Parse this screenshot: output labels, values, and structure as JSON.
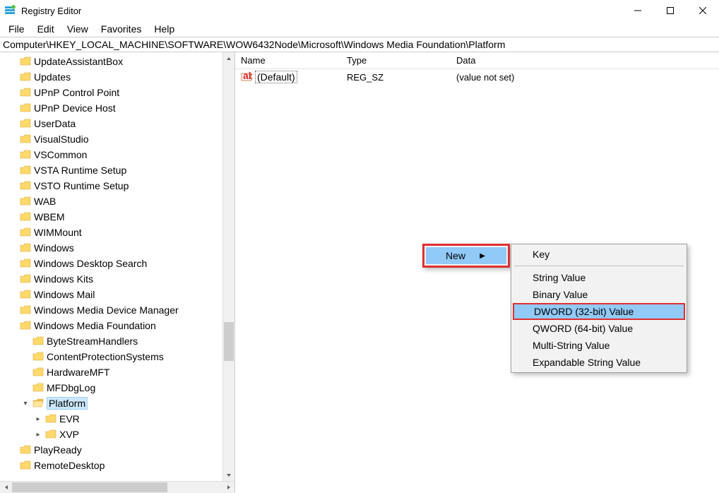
{
  "window": {
    "title": "Registry Editor"
  },
  "menubar": [
    "File",
    "Edit",
    "View",
    "Favorites",
    "Help"
  ],
  "address": "Computer\\HKEY_LOCAL_MACHINE\\SOFTWARE\\WOW6432Node\\Microsoft\\Windows Media Foundation\\Platform",
  "tree": {
    "items": [
      "UpdateAssistantBox",
      "Updates",
      "UPnP Control Point",
      "UPnP Device Host",
      "UserData",
      "VisualStudio",
      "VSCommon",
      "VSTA Runtime Setup",
      "VSTO Runtime Setup",
      "WAB",
      "WBEM",
      "WIMMount",
      "Windows",
      "Windows Desktop Search",
      "Windows Kits",
      "Windows Mail",
      "Windows Media Device Manager",
      "Windows Media Foundation"
    ],
    "wmf_children": [
      "ByteStreamHandlers",
      "ContentProtectionSystems",
      "HardwareMFT",
      "MFDbgLog",
      "Platform"
    ],
    "platform_children": [
      "EVR",
      "XVP"
    ],
    "after": [
      "PlayReady",
      "RemoteDesktop"
    ]
  },
  "list": {
    "headers": {
      "name": "Name",
      "type": "Type",
      "data": "Data"
    },
    "rows": [
      {
        "name": "(Default)",
        "type": "REG_SZ",
        "data": "(value not set)"
      }
    ]
  },
  "context": {
    "parent": {
      "new": "New"
    },
    "sub": [
      "Key",
      "String Value",
      "Binary Value",
      "DWORD (32-bit) Value",
      "QWORD (64-bit) Value",
      "Multi-String Value",
      "Expandable String Value"
    ]
  }
}
